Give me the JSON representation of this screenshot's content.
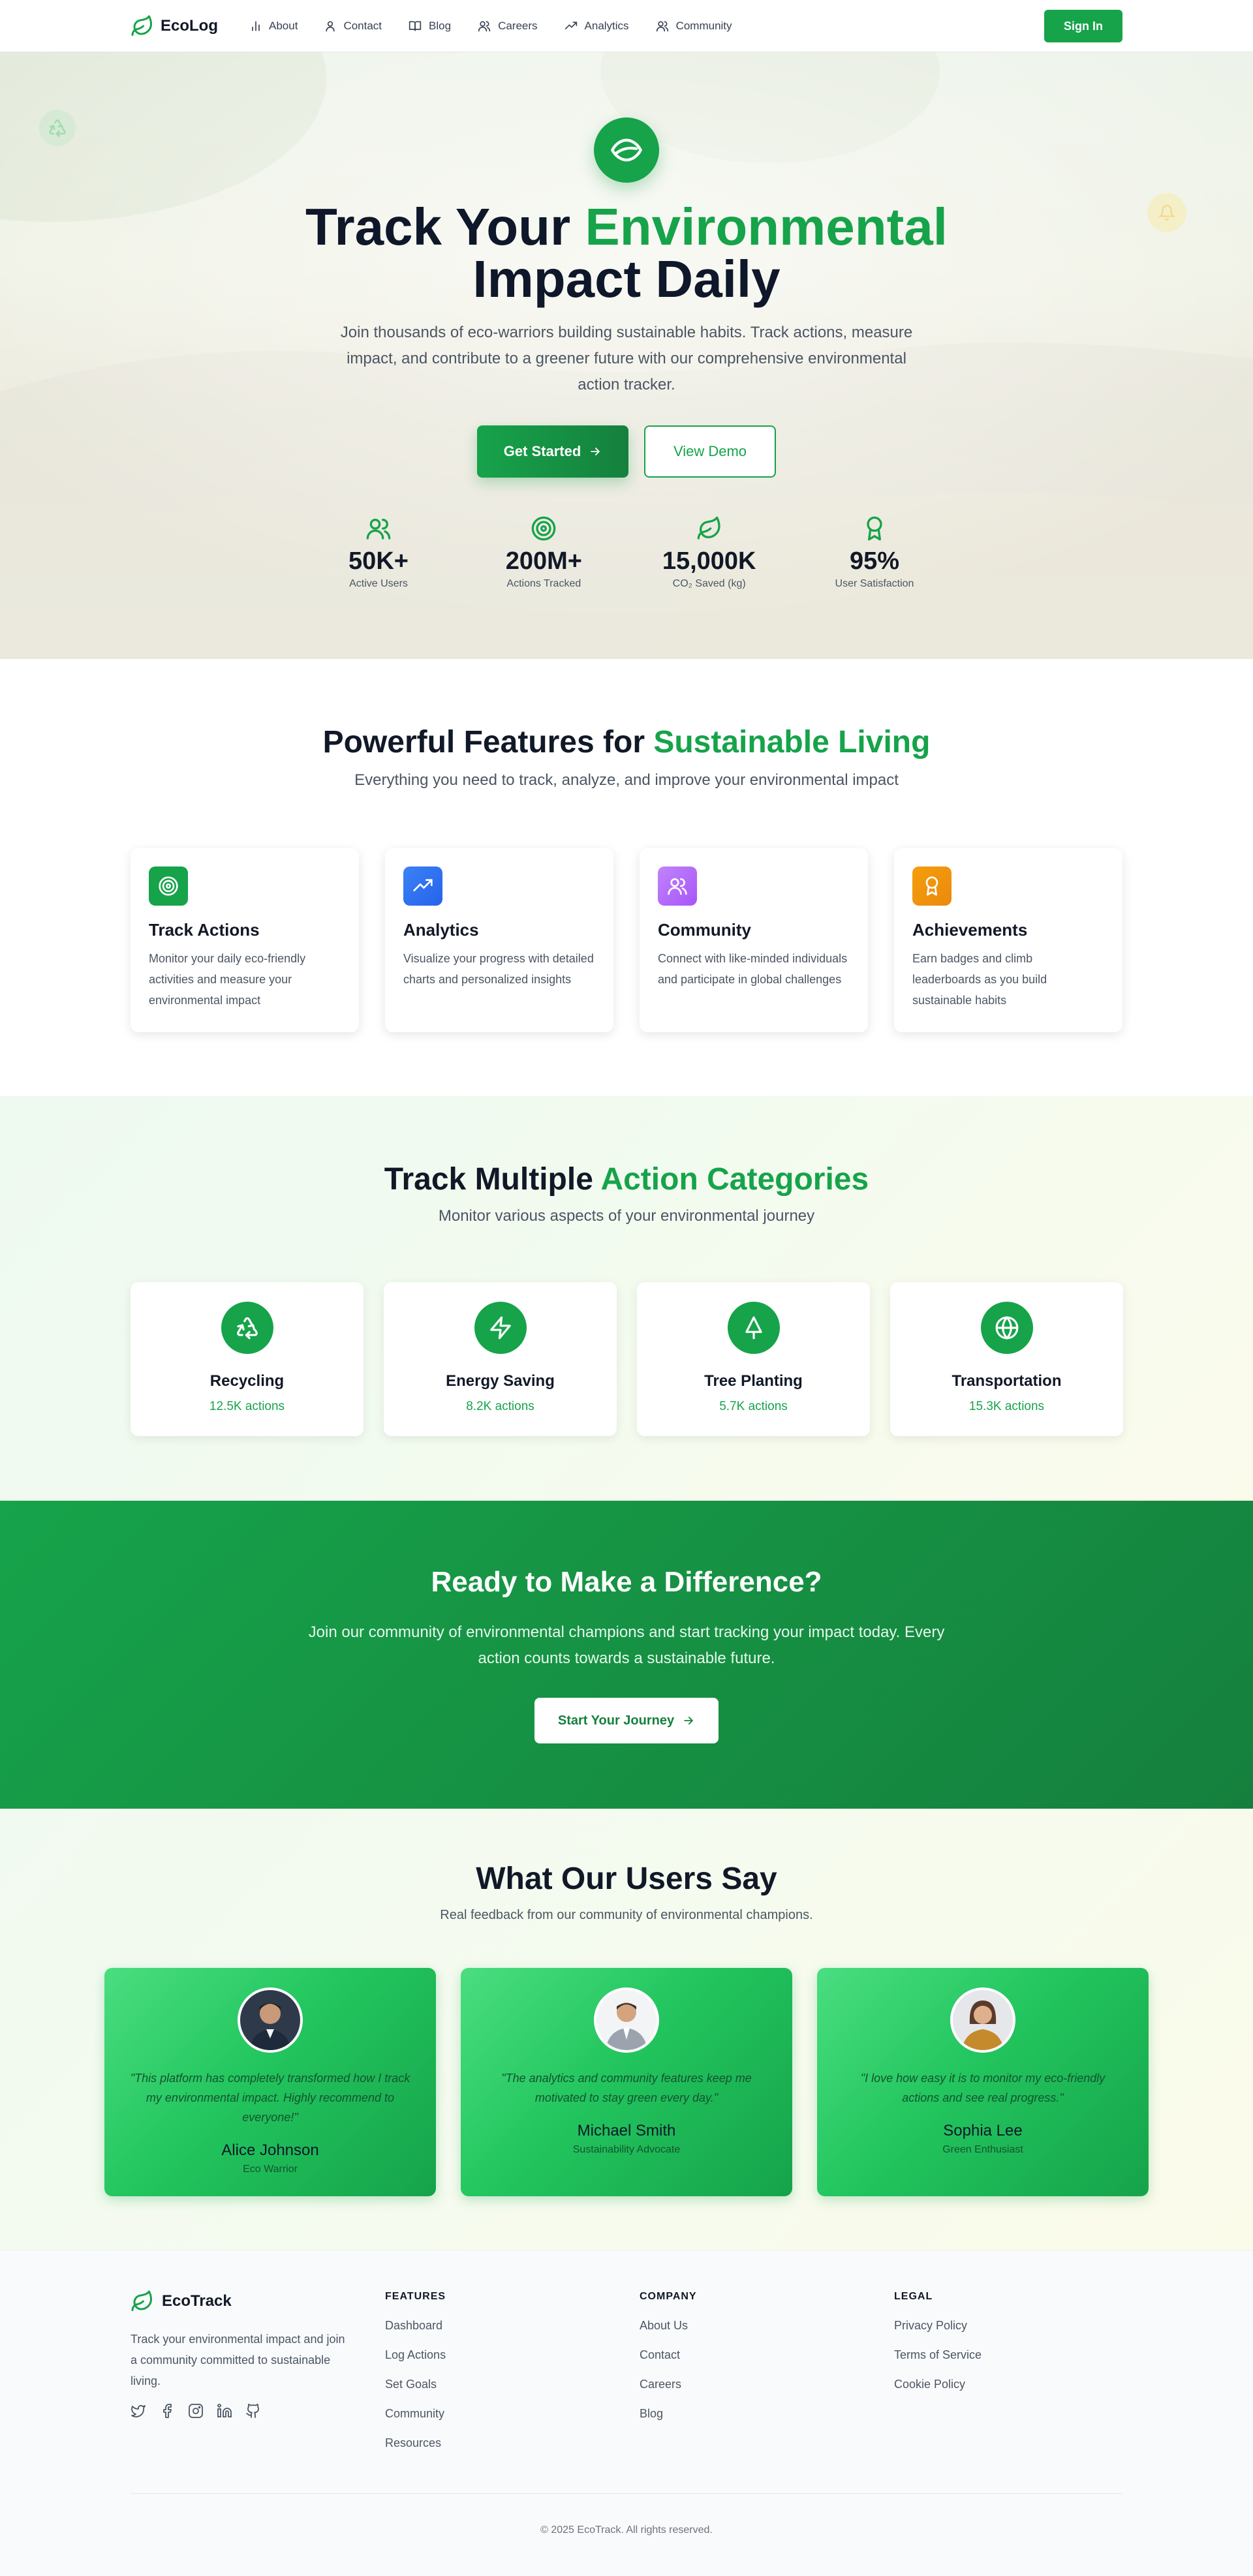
{
  "nav": {
    "brand": "EcoLog",
    "links": [
      {
        "label": "About",
        "icon": "bar-chart-icon"
      },
      {
        "label": "Contact",
        "icon": "user-icon"
      },
      {
        "label": "Blog",
        "icon": "book-icon"
      },
      {
        "label": "Careers",
        "icon": "users-icon"
      },
      {
        "label": "Analytics",
        "icon": "trending-up-icon"
      },
      {
        "label": "Community",
        "icon": "users-icon"
      }
    ],
    "signin_label": "Sign In"
  },
  "hero": {
    "title_prefix": "Track Your ",
    "title_accent": "Environmental",
    "title_suffix": "Impact Daily",
    "subtitle": "Join thousands of eco-warriors building sustainable habits. Track actions, measure impact, and contribute to a greener future with our comprehensive environmental action tracker.",
    "primary_cta": "Get Started",
    "secondary_cta": "View Demo",
    "stats": [
      {
        "value": "50K+",
        "label": "Active Users",
        "icon": "users-icon"
      },
      {
        "value": "200M+",
        "label": "Actions Tracked",
        "icon": "target-icon"
      },
      {
        "value": "15,000K",
        "label": "CO₂ Saved (kg)",
        "icon": "leaf-icon"
      },
      {
        "value": "95%",
        "label": "User Satisfaction",
        "icon": "award-icon"
      }
    ]
  },
  "features": {
    "title_prefix": "Powerful Features for ",
    "title_accent": "Sustainable Living",
    "subtitle": "Everything you need to track, analyze, and improve your environmental impact",
    "cards": [
      {
        "title": "Track Actions",
        "desc": "Monitor your daily eco-friendly activities and measure your environmental impact",
        "icon": "target-icon",
        "color": "#16a34a"
      },
      {
        "title": "Analytics",
        "desc": "Visualize your progress with detailed charts and personalized insights",
        "icon": "trending-up-icon",
        "color": "#2563eb"
      },
      {
        "title": "Community",
        "desc": "Connect with like-minded individuals and participate in global challenges",
        "icon": "users-icon",
        "color": "#a855f7"
      },
      {
        "title": "Achievements",
        "desc": "Earn badges and climb leaderboards as you build sustainable habits",
        "icon": "award-icon",
        "color": "#f59e0b"
      }
    ]
  },
  "categories": {
    "title_prefix": "Track Multiple ",
    "title_accent": "Action Categories",
    "subtitle": "Monitor various aspects of your environmental journey",
    "items": [
      {
        "name": "Recycling",
        "count": "12.5K actions",
        "icon": "recycle-icon"
      },
      {
        "name": "Energy Saving",
        "count": "8.2K actions",
        "icon": "zap-icon"
      },
      {
        "name": "Tree Planting",
        "count": "5.7K actions",
        "icon": "tree-icon"
      },
      {
        "name": "Transportation",
        "count": "15.3K actions",
        "icon": "globe-icon"
      }
    ]
  },
  "cta": {
    "title": "Ready to Make a Difference?",
    "subtitle": "Join our community of environmental champions and start tracking your impact today. Every action counts towards a sustainable future.",
    "button": "Start Your Journey"
  },
  "testimonials": {
    "title": "What Our Users Say",
    "subtitle": "Real feedback from our community of environmental champions.",
    "items": [
      {
        "quote": "\"This platform has completely transformed how I track my environmental impact. Highly recommend to everyone!\"",
        "name": "Alice Johnson",
        "role": "Eco Warrior"
      },
      {
        "quote": "\"The analytics and community features keep me motivated to stay green every day.\"",
        "name": "Michael Smith",
        "role": "Sustainability Advocate"
      },
      {
        "quote": "\"I love how easy it is to monitor my eco-friendly actions and see real progress.\"",
        "name": "Sophia Lee",
        "role": "Green Enthusiast"
      }
    ]
  },
  "footer": {
    "brand": "EcoTrack",
    "about": "Track your environmental impact and join a community committed to sustainable living.",
    "social": [
      "twitter-icon",
      "facebook-icon",
      "instagram-icon",
      "linkedin-icon",
      "github-icon"
    ],
    "columns": [
      {
        "title": "FEATURES",
        "links": [
          "Dashboard",
          "Log Actions",
          "Set Goals",
          "Community",
          "Resources"
        ]
      },
      {
        "title": "COMPANY",
        "links": [
          "About Us",
          "Contact",
          "Careers",
          "Blog"
        ]
      },
      {
        "title": "LEGAL",
        "links": [
          "Privacy Policy",
          "Terms of Service",
          "Cookie Policy"
        ]
      }
    ],
    "copyright": "© 2025 EcoTrack. All rights reserved."
  },
  "colors": {
    "brand_green": "#16a34a",
    "dark_green": "#15803d",
    "text_dark": "#111827",
    "text_muted": "#4b5563"
  }
}
